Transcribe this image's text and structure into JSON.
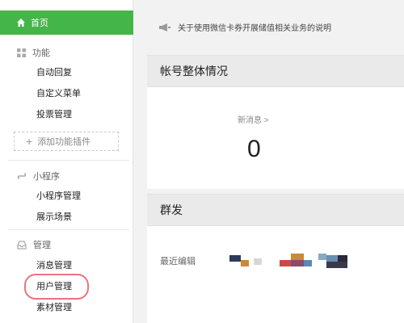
{
  "sidebar": {
    "home_label": "首页",
    "sections": [
      {
        "title": "功能",
        "items": [
          "自动回复",
          "自定义菜单",
          "投票管理"
        ]
      },
      {
        "title": "小程序",
        "items": [
          "小程序管理",
          "展示场景"
        ]
      },
      {
        "title": "管理",
        "items": [
          "消息管理",
          "用户管理",
          "素材管理"
        ]
      }
    ],
    "add_plugin_label": "添加功能插件"
  },
  "main": {
    "notice_text": "关于使用微信卡券开展储值相关业务的说明",
    "account_panel_title": "帐号整体情况",
    "new_messages_label": "新消息 >",
    "new_messages_count": "0",
    "broadcast_panel_title": "群发",
    "recent_edit_label": "最近编辑"
  },
  "colors": {
    "accent_green": "#44b549",
    "highlight_red": "#e8757d"
  }
}
